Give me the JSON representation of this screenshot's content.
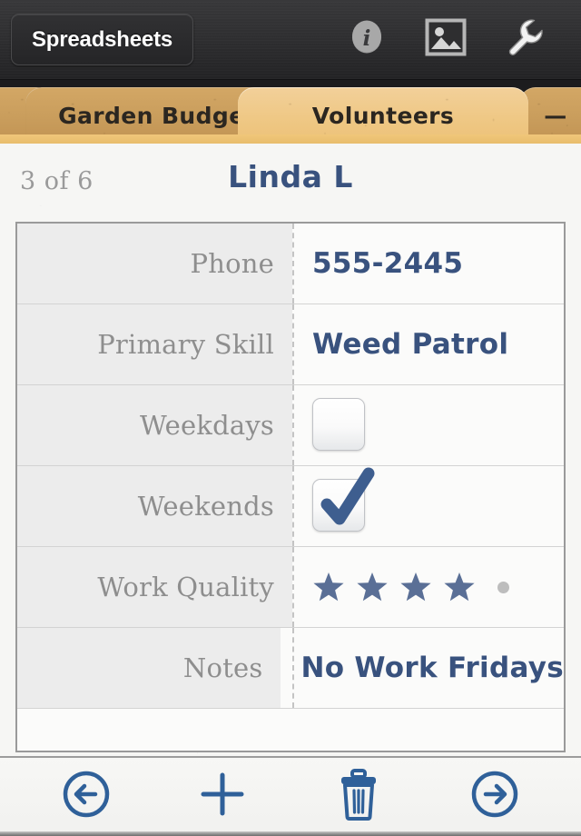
{
  "topbar": {
    "back_button_label": "Spreadsheets",
    "icons": [
      {
        "name": "info-icon",
        "glyph": "i"
      },
      {
        "name": "photo-icon",
        "glyph": "picture"
      },
      {
        "name": "wrench-icon",
        "glyph": "wrench"
      }
    ]
  },
  "tabs": [
    {
      "label": "",
      "active": false,
      "partial": true
    },
    {
      "label": "Garden Budget",
      "active": false,
      "partial": false
    },
    {
      "label": "Volunteers",
      "active": true,
      "partial": false
    },
    {
      "label": "—",
      "active": false,
      "partial": true
    }
  ],
  "record": {
    "counter": "3 of 6",
    "name": "Linda L"
  },
  "fields": [
    {
      "label": "Phone",
      "type": "text",
      "value": "555-2445"
    },
    {
      "label": "Primary Skill",
      "type": "text",
      "value": "Weed Patrol"
    },
    {
      "label": "Weekdays",
      "type": "checkbox",
      "checked": false
    },
    {
      "label": "Weekends",
      "type": "checkbox",
      "checked": true
    },
    {
      "label": "Work Quality",
      "type": "rating",
      "value": 4,
      "max": 5
    },
    {
      "label": "Notes",
      "type": "text",
      "value": "No Work Fridays"
    },
    {
      "label": "",
      "type": "empty",
      "value": ""
    }
  ],
  "toolbar": [
    {
      "name": "previous-record-button",
      "glyph": "arrow-left-circle"
    },
    {
      "name": "add-record-button",
      "glyph": "plus"
    },
    {
      "name": "delete-record-button",
      "glyph": "trash"
    },
    {
      "name": "next-record-button",
      "glyph": "arrow-right-circle"
    }
  ],
  "colors": {
    "accent_blue": "#39527e",
    "star_blue": "#5a6f96",
    "label_gray": "#8e8e8e",
    "tab_active": "#efc885",
    "tab_inactive": "#c99d5c",
    "toolbar_blue": "#2f6099"
  }
}
